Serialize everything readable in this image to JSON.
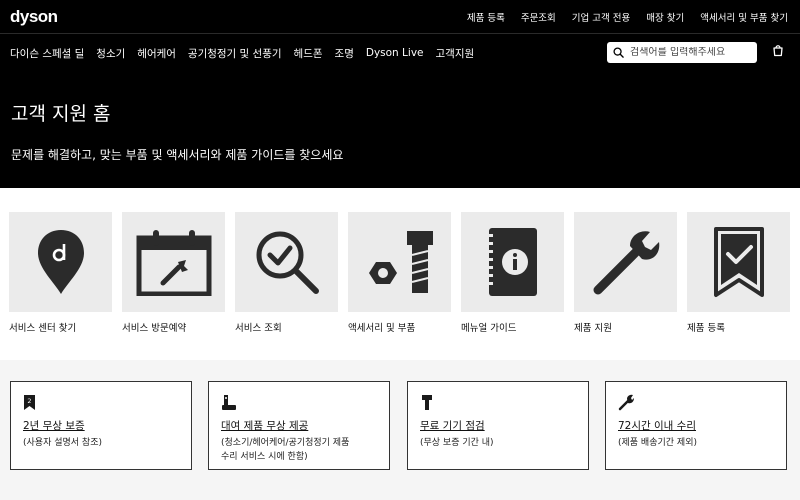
{
  "brand": {
    "logo": "dyson"
  },
  "utility_nav": [
    "제품 등록",
    "주문조회",
    "기업 고객 전용",
    "매장 찾기",
    "액세서리 및 부품 찾기"
  ],
  "main_nav": [
    "다이슨 스페셜 딜",
    "청소기",
    "헤어케어",
    "공기청정기 및 선풍기",
    "헤드폰",
    "조명",
    "Dyson Live",
    "고객지원"
  ],
  "search": {
    "placeholder": "검색어를 입력해주세요"
  },
  "hero": {
    "title": "고객 지원 홈",
    "subtitle": "문제를 해결하고, 맞는 부품 및 액세서리와 제품 가이드를 찾으세요"
  },
  "tiles": [
    {
      "label": "서비스 센터 찾기",
      "icon": "location-pin-icon"
    },
    {
      "label": "서비스 방문예약",
      "icon": "calendar-wrench-icon"
    },
    {
      "label": "서비스 조회",
      "icon": "magnifier-check-icon"
    },
    {
      "label": "액세서리 및 부품",
      "icon": "nut-bolt-icon"
    },
    {
      "label": "메뉴얼 가이드",
      "icon": "manual-info-icon"
    },
    {
      "label": "제품 지원",
      "icon": "wrench-icon"
    },
    {
      "label": "제품 등록",
      "icon": "bookmark-check-icon"
    }
  ],
  "cards": [
    {
      "icon": "warranty-badge-icon",
      "badge": "2",
      "title": "2년 무상 보증",
      "sub": [
        "(사용자 설명서 참조)"
      ]
    },
    {
      "icon": "loan-device-icon",
      "title": "대여 제품 무상 제공",
      "sub": [
        "(청소기/헤어케어/공기청정기 제품",
        "수리 서비스 시에 한함)"
      ]
    },
    {
      "icon": "bolt-icon",
      "title": "무료 기기 점검",
      "sub": [
        "(무상 보증 기간 내)"
      ]
    },
    {
      "icon": "wrench-small-icon",
      "title": "72시간 이내 수리",
      "sub": [
        "(제품 배송기간 제외)"
      ]
    }
  ]
}
